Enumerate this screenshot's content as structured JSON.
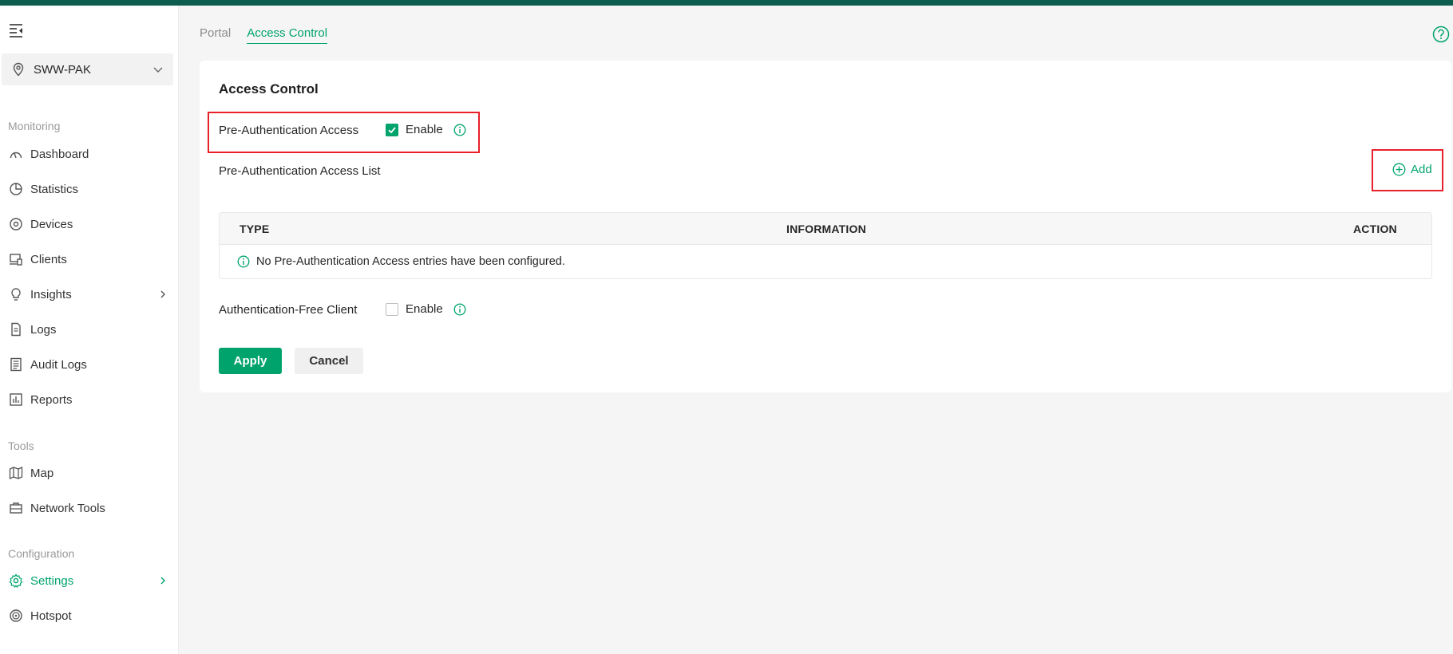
{
  "sidebar": {
    "site_name": "SWW-PAK",
    "sections": {
      "monitoring": "Monitoring",
      "tools": "Tools",
      "configuration": "Configuration"
    },
    "items": {
      "dashboard": "Dashboard",
      "statistics": "Statistics",
      "devices": "Devices",
      "clients": "Clients",
      "insights": "Insights",
      "logs": "Logs",
      "audit_logs": "Audit Logs",
      "reports": "Reports",
      "map": "Map",
      "network_tools": "Network Tools",
      "settings": "Settings",
      "hotspot": "Hotspot"
    },
    "active_item": "Settings"
  },
  "tabs": {
    "portal": "Portal",
    "access_control": "Access Control",
    "active": "Access Control"
  },
  "card": {
    "title": "Access Control",
    "pre_auth": {
      "label": "Pre-Authentication Access",
      "enable_label": "Enable",
      "checked": true
    },
    "pre_auth_list_label": "Pre-Authentication Access List",
    "add_label": "Add",
    "table": {
      "columns": [
        "TYPE",
        "INFORMATION",
        "ACTION"
      ],
      "empty_message": "No Pre-Authentication Access entries have been configured."
    },
    "auth_free": {
      "label": "Authentication-Free Client",
      "enable_label": "Enable",
      "checked": false
    },
    "apply_label": "Apply",
    "cancel_label": "Cancel"
  },
  "colors": {
    "accent": "#00a36c",
    "topbar": "#0d5e4f",
    "highlight": "#e8202a"
  }
}
